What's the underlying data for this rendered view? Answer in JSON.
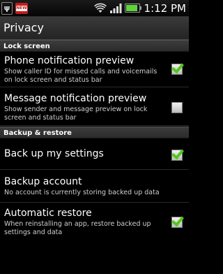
{
  "status_bar": {
    "time": "1:12 PM",
    "icons": [
      "usb-icon",
      "notification-icon",
      "wifi-icon",
      "signal-icon",
      "battery-icon"
    ]
  },
  "title": "Privacy",
  "sections": {
    "lock_screen": "Lock screen",
    "backup_restore": "Backup & restore"
  },
  "settings": {
    "phone_notification_preview": {
      "title": "Phone notification preview",
      "summary": "Show caller ID for missed calls and voicemails on lock screen and status bar",
      "checked": true
    },
    "message_notification_preview": {
      "title": "Message notification preview",
      "summary": "Show sender and message preview on lock screen and status bar",
      "checked": false
    },
    "back_up_my_settings": {
      "title": "Back up my settings",
      "checked": true
    },
    "backup_account": {
      "title": "Backup account",
      "summary": "No account is currently storing backed up data"
    },
    "automatic_restore": {
      "title": "Automatic restore",
      "summary": "When reinstalling an app, restore backed up settings and data",
      "checked": true
    }
  },
  "colors": {
    "checkmark": "#56c51b",
    "background": "#000000"
  }
}
